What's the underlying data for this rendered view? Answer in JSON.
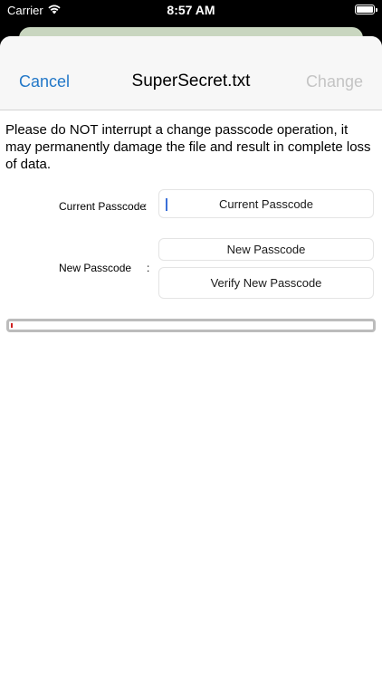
{
  "status_bar": {
    "carrier": "Carrier",
    "time": "8:57 AM",
    "wifi_icon": "wifi-icon",
    "battery_icon": "battery-icon"
  },
  "nav": {
    "cancel_label": "Cancel",
    "title": "SuperSecret.txt",
    "change_label": "Change"
  },
  "warning_text": "Please do NOT interrupt a change passcode operation, it may permanently damage the file and result in complete loss of data.",
  "form": {
    "current_label": "Current Passcode",
    "current_placeholder": "Current Passcode",
    "new_label": "New Passcode",
    "new_placeholder": "New Passcode",
    "verify_placeholder": "Verify New Passcode",
    "separator": ":"
  },
  "progress": {
    "fraction": 0.0,
    "track_color": "#bcbcbc",
    "fill_color": "#d02020"
  },
  "colors": {
    "accent": "#2378c8",
    "disabled": "#c4c4c4"
  }
}
